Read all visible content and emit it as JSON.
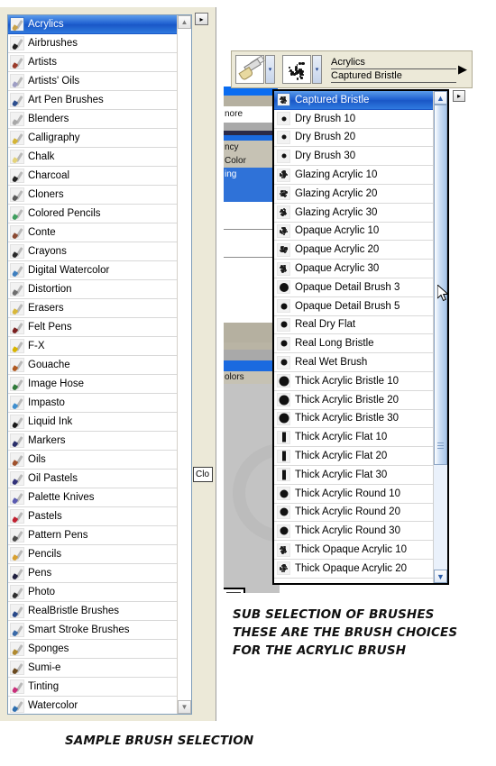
{
  "left_panel": {
    "name": "Brush Category Selector",
    "selected": "Acrylics",
    "categories": [
      {
        "label": "Acrylics",
        "icon": "brush-acrylic-icon",
        "color": "#c8a24a"
      },
      {
        "label": "Airbrushes",
        "icon": "brush-airbrush-icon",
        "color": "#1f1f1f"
      },
      {
        "label": "Artists",
        "icon": "brush-artists-icon",
        "color": "#9b3b2a"
      },
      {
        "label": "Artists' Oils",
        "icon": "brush-artists-oils-icon",
        "color": "#9f9fc4"
      },
      {
        "label": "Art Pen Brushes",
        "icon": "brush-art-pen-icon",
        "color": "#2e4f8f"
      },
      {
        "label": "Blenders",
        "icon": "brush-blenders-icon",
        "color": "#a8a8a8"
      },
      {
        "label": "Calligraphy",
        "icon": "brush-calligraphy-icon",
        "color": "#d4b436"
      },
      {
        "label": "Chalk",
        "icon": "brush-chalk-icon",
        "color": "#e3d27a"
      },
      {
        "label": "Charcoal",
        "icon": "brush-charcoal-icon",
        "color": "#222222"
      },
      {
        "label": "Cloners",
        "icon": "brush-cloners-icon",
        "color": "#5a5a5a"
      },
      {
        "label": "Colored Pencils",
        "icon": "brush-colored-pencils-icon",
        "color": "#3f9f5f"
      },
      {
        "label": "Conte",
        "icon": "brush-conte-icon",
        "color": "#8b4a32"
      },
      {
        "label": "Crayons",
        "icon": "brush-crayons-icon",
        "color": "#2a2a2a"
      },
      {
        "label": "Digital Watercolor",
        "icon": "brush-digital-watercolor-icon",
        "color": "#3f7fbf"
      },
      {
        "label": "Distortion",
        "icon": "brush-distortion-icon",
        "color": "#6f6f6f"
      },
      {
        "label": "Erasers",
        "icon": "brush-erasers-icon",
        "color": "#d8b73a"
      },
      {
        "label": "Felt Pens",
        "icon": "brush-felt-pens-icon",
        "color": "#7a2020"
      },
      {
        "label": "F-X",
        "icon": "brush-fx-icon",
        "color": "#d8b400"
      },
      {
        "label": "Gouache",
        "icon": "brush-gouache-icon",
        "color": "#b05a22"
      },
      {
        "label": "Image Hose",
        "icon": "brush-image-hose-icon",
        "color": "#2f7a3a"
      },
      {
        "label": "Impasto",
        "icon": "brush-impasto-icon",
        "color": "#3f8fcf"
      },
      {
        "label": "Liquid Ink",
        "icon": "brush-liquid-ink-icon",
        "color": "#1a1a1a"
      },
      {
        "label": "Markers",
        "icon": "brush-markers-icon",
        "color": "#2a2f6a"
      },
      {
        "label": "Oils",
        "icon": "brush-oils-icon",
        "color": "#a0522d"
      },
      {
        "label": "Oil Pastels",
        "icon": "brush-oil-pastels-icon",
        "color": "#32327a"
      },
      {
        "label": "Palette Knives",
        "icon": "brush-palette-knives-icon",
        "color": "#5a5ab0"
      },
      {
        "label": "Pastels",
        "icon": "brush-pastels-icon",
        "color": "#c02030"
      },
      {
        "label": "Pattern Pens",
        "icon": "brush-pattern-pens-icon",
        "color": "#4a4a4a"
      },
      {
        "label": "Pencils",
        "icon": "brush-pencils-icon",
        "color": "#d8a030"
      },
      {
        "label": "Pens",
        "icon": "brush-pens-icon",
        "color": "#1f1f3f"
      },
      {
        "label": "Photo",
        "icon": "brush-photo-icon",
        "color": "#303030"
      },
      {
        "label": "RealBristle Brushes",
        "icon": "brush-realbristle-icon",
        "color": "#2a4a8a"
      },
      {
        "label": "Smart Stroke Brushes",
        "icon": "brush-smart-stroke-icon",
        "color": "#3a6aa8"
      },
      {
        "label": "Sponges",
        "icon": "brush-sponges-icon",
        "color": "#b08a30"
      },
      {
        "label": "Sumi-e",
        "icon": "brush-sumie-icon",
        "color": "#6a4a20"
      },
      {
        "label": "Tinting",
        "icon": "brush-tinting-icon",
        "color": "#c8307a"
      },
      {
        "label": "Watercolor",
        "icon": "brush-watercolor-icon",
        "color": "#2f6fb0"
      }
    ],
    "scrollbar": {
      "up_arrow": "▲",
      "down_arrow": "▼"
    },
    "expand_button": "▸",
    "close_tooltip": "Clo"
  },
  "toolbar": {
    "brush_tool_icon": "paintbrush-icon",
    "brush_dropdown_arrow": "▾",
    "variant_preview_icon": "brush-dab-pattern-icon",
    "variant_dropdown_arrow": "▾",
    "category_name": "Acrylics",
    "variant_name": "Captured Bristle",
    "more_arrow": "▶"
  },
  "variant_dropdown": {
    "name": "Acrylics brush variants",
    "selected": "Captured Bristle",
    "items": [
      {
        "label": "Captured Bristle",
        "dab": "splat",
        "size": 9
      },
      {
        "label": "Dry Brush 10",
        "dab": "dot",
        "size": 5
      },
      {
        "label": "Dry Brush 20",
        "dab": "dot",
        "size": 5
      },
      {
        "label": "Dry Brush 30",
        "dab": "dot",
        "size": 5
      },
      {
        "label": "Glazing Acrylic 10",
        "dab": "splat",
        "size": 9
      },
      {
        "label": "Glazing Acrylic 20",
        "dab": "splat",
        "size": 9
      },
      {
        "label": "Glazing Acrylic 30",
        "dab": "splat",
        "size": 8
      },
      {
        "label": "Opaque Acrylic 10",
        "dab": "splat",
        "size": 9
      },
      {
        "label": "Opaque Acrylic 20",
        "dab": "splat",
        "size": 8
      },
      {
        "label": "Opaque Acrylic 30",
        "dab": "splat",
        "size": 8
      },
      {
        "label": "Opaque Detail Brush 3",
        "dab": "dot",
        "size": 10
      },
      {
        "label": "Opaque Detail Brush 5",
        "dab": "dot",
        "size": 7
      },
      {
        "label": "Real Dry Flat",
        "dab": "dot",
        "size": 7
      },
      {
        "label": "Real Long Bristle",
        "dab": "dot",
        "size": 7
      },
      {
        "label": "Real Wet Brush",
        "dab": "dot",
        "size": 7
      },
      {
        "label": "Thick Acrylic Bristle 10",
        "dab": "dot",
        "size": 11
      },
      {
        "label": "Thick Acrylic Bristle 20",
        "dab": "dot",
        "size": 11
      },
      {
        "label": "Thick Acrylic Bristle 30",
        "dab": "dot",
        "size": 11
      },
      {
        "label": "Thick Acrylic Flat 10",
        "dab": "flat",
        "size": 4
      },
      {
        "label": "Thick Acrylic Flat 20",
        "dab": "flat",
        "size": 4
      },
      {
        "label": "Thick Acrylic Flat 30",
        "dab": "flat",
        "size": 4
      },
      {
        "label": "Thick Acrylic Round 10",
        "dab": "dot",
        "size": 9
      },
      {
        "label": "Thick Acrylic Round 20",
        "dab": "dot",
        "size": 9
      },
      {
        "label": "Thick Acrylic Round 30",
        "dab": "dot",
        "size": 9
      },
      {
        "label": "Thick Opaque Acrylic 10",
        "dab": "splat",
        "size": 9
      },
      {
        "label": "Thick Opaque Acrylic 20",
        "dab": "splat",
        "size": 9
      }
    ],
    "scrollbar": {
      "up_arrow": "▲",
      "down_arrow": "▼"
    },
    "expand_button": "▸"
  },
  "background": {
    "fragment_texts": [
      "nore",
      "ncy",
      "Color",
      "ing",
      "olors"
    ]
  },
  "captions": {
    "right_line1": "SUB SELECTION OF BRUSHES",
    "right_line2": "THESE ARE THE BRUSH CHOICES",
    "right_line3": "FOR THE ACRYLIC BRUSH",
    "left": "SAMPLE BRUSH SELECTION"
  },
  "colors": {
    "selection_blue": "#1e5fd0",
    "panel_beige": "#ece9d8",
    "scroll_blue": "#a8c6ea"
  }
}
